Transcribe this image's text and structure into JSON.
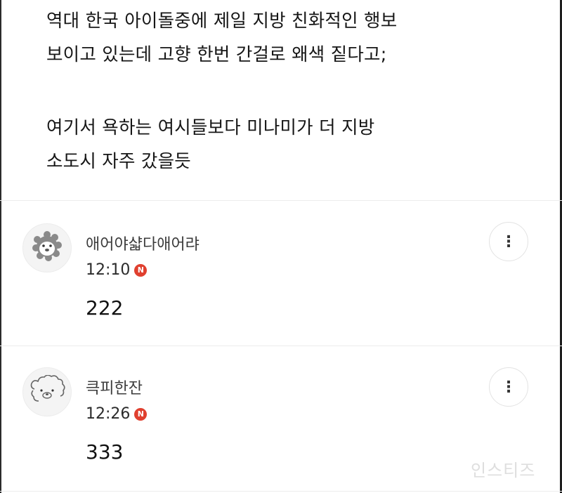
{
  "post": {
    "lines": [
      "역대 한국 아이돌중에 제일 지방 친화적인 행보",
      "보이고 있는데 고향 한번 간걸로 왜색 짙다고;",
      "여기서 욕하는 여시들보다 미나미가 더 지방",
      "소도시 자주 갔을듯"
    ]
  },
  "comments": [
    {
      "nickname": "애어야샯다애어랴",
      "time": "12:10",
      "badge": "N",
      "content": "222",
      "avatar_icon": "lion-face-icon",
      "more_icon": "⋮"
    },
    {
      "nickname": "큭피한잔",
      "time": "12:26",
      "badge": "N",
      "content": "333",
      "avatar_icon": "fluffy-dog-icon",
      "more_icon": "⋮"
    }
  ],
  "watermark": "인스티즈",
  "colors": {
    "badge": "#e0402f",
    "divider": "#ececec",
    "text": "#161616"
  }
}
